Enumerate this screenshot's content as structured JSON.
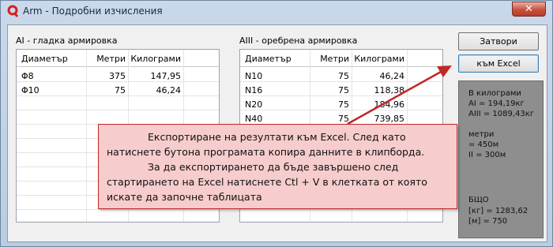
{
  "window": {
    "title": "Arm - Подробни изчисления",
    "close_label": "✕"
  },
  "left_group": {
    "label": "AI - гладка армировка",
    "columns": [
      "Диаметър",
      "Метри",
      "Килограми"
    ],
    "rows": [
      {
        "d": "Φ8",
        "m": "375",
        "kg": "147,95"
      },
      {
        "d": "Φ10",
        "m": "75",
        "kg": "46,24"
      }
    ]
  },
  "right_group": {
    "label": "AIII - оребрена армировка",
    "columns": [
      "Диаметър",
      "Метри",
      "Килограми"
    ],
    "rows": [
      {
        "d": "N10",
        "m": "75",
        "kg": "46,24"
      },
      {
        "d": "N16",
        "m": "75",
        "kg": "118,38"
      },
      {
        "d": "N20",
        "m": "75",
        "kg": "184,96"
      },
      {
        "d": "N40",
        "m": "75",
        "kg": "739,85"
      }
    ]
  },
  "buttons": {
    "close": "Затвори",
    "excel": "към Excel"
  },
  "summary": {
    "line1": "В килограми",
    "line2": "AI = 194,19кг",
    "line3": "AIII = 1089,43кг",
    "line4": "метри",
    "line5": "= 450м",
    "line6": "II = 300м",
    "line7": "БЩО",
    "line8": "[кг] = 1283,62",
    "line9": "[м] = 750"
  },
  "callout": {
    "p1": "Експортиране на резултати към Excel. След като натиснете бутона програмата копира данните в клипборда.",
    "p2": "За да експортирането да бъде завършено след стартирането на Excel натиснете Ctl + V в клетката от която искате да започне таблицата"
  },
  "colors": {
    "accent_red": "#c02828",
    "callout_bg": "#f6cccc"
  }
}
